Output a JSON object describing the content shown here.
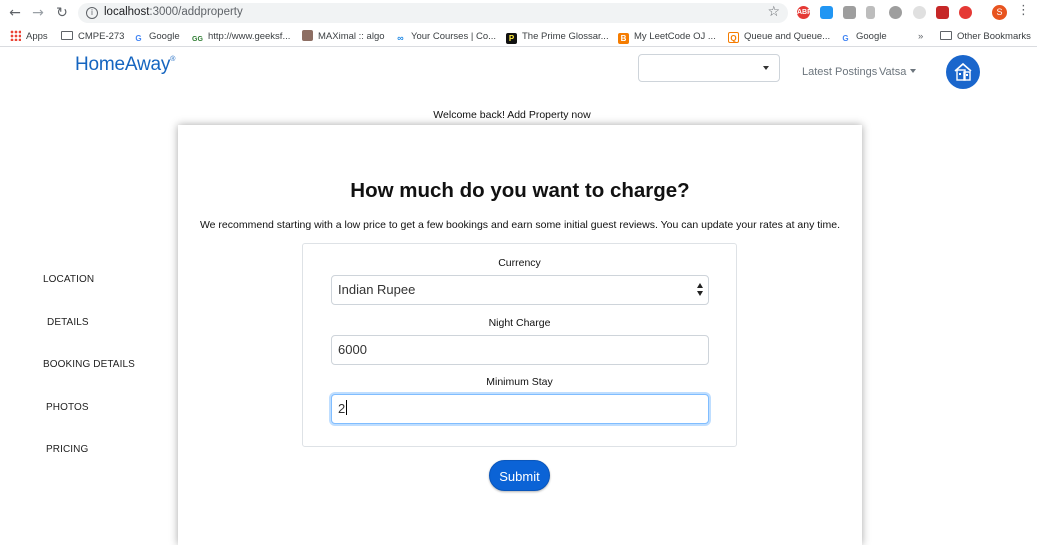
{
  "browser": {
    "url_host": "localhost",
    "url_path": ":3000/addproperty",
    "profile_initial": "S",
    "bookmarks": [
      {
        "label": "Apps",
        "icon": "apps-grid-icon"
      },
      {
        "label": "CMPE-273",
        "icon": "folder-icon"
      },
      {
        "label": "Google",
        "icon": "google-icon"
      },
      {
        "label": "http://www.geeksf...",
        "icon": "geeksforgeeks-icon"
      },
      {
        "label": "MAXimal :: algo",
        "icon": "maximal-icon"
      },
      {
        "label": "Your Courses | Co...",
        "icon": "coursera-icon"
      },
      {
        "label": "The Prime Glossar...",
        "icon": "prime-icon"
      },
      {
        "label": "My LeetCode OJ ...",
        "icon": "blogger-icon"
      },
      {
        "label": "Queue and Queue...",
        "icon": "queue-icon"
      },
      {
        "label": "Google",
        "icon": "google-icon"
      }
    ],
    "overflow": "»",
    "other_bookmarks": "Other Bookmarks"
  },
  "header": {
    "logo": "HomeAway",
    "logo_mark": "®",
    "nav_latest": "Latest Postings",
    "user_name": "Vatsa",
    "accent": "#1a66cc"
  },
  "welcome_text": "Welcome back! Add Property now",
  "sidebar": {
    "items": [
      {
        "label": "LOCATION"
      },
      {
        "label": "DETAILS"
      },
      {
        "label": "BOOKING DETAILS"
      },
      {
        "label": "PHOTOS"
      },
      {
        "label": "PRICING"
      }
    ]
  },
  "card": {
    "title": "How much do you want to charge?",
    "subtitle": "We recommend starting with a low price to get a few bookings and earn some initial guest reviews. You can update your rates at any time.",
    "currency_label": "Currency",
    "currency_value": "Indian Rupee",
    "night_charge_label": "Night Charge",
    "night_charge_value": "6000",
    "min_stay_label": "Minimum Stay",
    "min_stay_value": "2",
    "submit_label": "Submit",
    "submit_color": "#0b63d6"
  }
}
